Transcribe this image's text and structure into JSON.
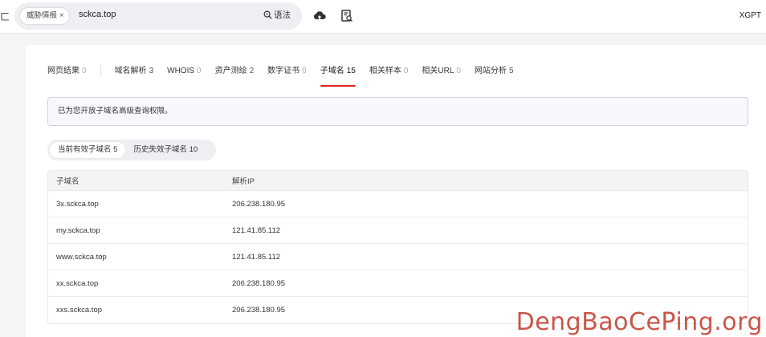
{
  "topbar": {
    "back_glyph": "ㄈ",
    "filter_tag": "威胁情报",
    "filter_tag_close": "×",
    "query": "sckca.top",
    "syntax_label": "语法",
    "user_label": "XGPT"
  },
  "tabs": [
    {
      "label": "网页结果",
      "count": "0"
    },
    {
      "label": "域名解析",
      "count": "3"
    },
    {
      "label": "WHOIS",
      "count": "0"
    },
    {
      "label": "资产测绘",
      "count": "2"
    },
    {
      "label": "数字证书",
      "count": "0"
    },
    {
      "label": "子域名",
      "count": "15"
    },
    {
      "label": "相关样本",
      "count": "0"
    },
    {
      "label": "相关URL",
      "count": "0"
    },
    {
      "label": "网站分析",
      "count": "5"
    }
  ],
  "notice": "已为您开放子域名高级查询权限。",
  "segments": {
    "active": "当前有效子域名 5",
    "history": "历史失效子域名 10"
  },
  "table": {
    "headers": [
      "子域名",
      "解析IP"
    ],
    "rows": [
      [
        "3x.sckca.top",
        "206.238.180.95"
      ],
      [
        "my.sckca.top",
        "121.41.85.112"
      ],
      [
        "www.sckca.top",
        "121.41.85.112"
      ],
      [
        "xx.sckca.top",
        "206.238.180.95"
      ],
      [
        "xxs.sckca.top",
        "206.238.180.95"
      ]
    ]
  },
  "watermark": "DengBaoCePing.org",
  "colors": {
    "accent": "#e02020",
    "watermark": "#c0392b"
  }
}
